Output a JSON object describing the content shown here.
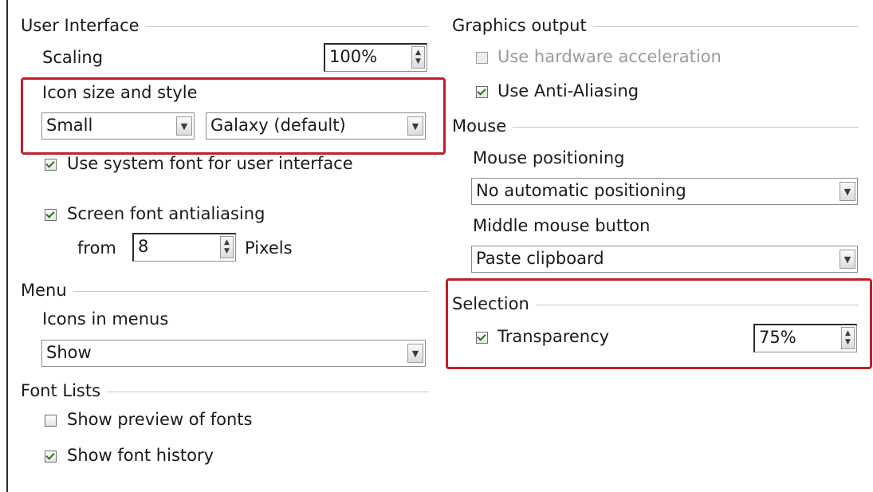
{
  "user_interface": {
    "heading": "User Interface",
    "scaling": {
      "label": "Scaling",
      "value": "100%"
    },
    "icon_size_style": {
      "label": "Icon size and style",
      "size_value": "Small",
      "style_value": "Galaxy (default)"
    },
    "system_font": {
      "label": "Use system font for user interface",
      "checked": true
    },
    "antialiasing": {
      "label": "Screen font antialiasing",
      "checked": true
    },
    "from_label": "from",
    "from_value": "8",
    "pixels_label": "Pixels"
  },
  "menu": {
    "heading": "Menu",
    "icons_label": "Icons in menus",
    "icons_value": "Show"
  },
  "font_lists": {
    "heading": "Font Lists",
    "preview": {
      "label": "Show preview of fonts",
      "checked": false
    },
    "history": {
      "label": "Show font history",
      "checked": true
    }
  },
  "graphics_output": {
    "heading": "Graphics output",
    "hardware_accel": {
      "label": "Use hardware acceleration",
      "checked": false,
      "disabled": true
    },
    "anti_aliasing": {
      "label": "Use Anti-Aliasing",
      "checked": true
    }
  },
  "mouse": {
    "heading": "Mouse",
    "positioning_label": "Mouse positioning",
    "positioning_value": "No automatic positioning",
    "middle_label": "Middle mouse button",
    "middle_value": "Paste clipboard"
  },
  "selection": {
    "heading": "Selection",
    "transparency": {
      "label": "Transparency",
      "checked": true
    },
    "transparency_value": "75%"
  },
  "colors": {
    "highlight": "#c0202a",
    "disabled_text": "#9a9a9a"
  },
  "icons": {
    "dropdown": "chevron-down-icon",
    "spinner": "spin-arrows-icon",
    "checkbox": "checkbox-icon"
  }
}
